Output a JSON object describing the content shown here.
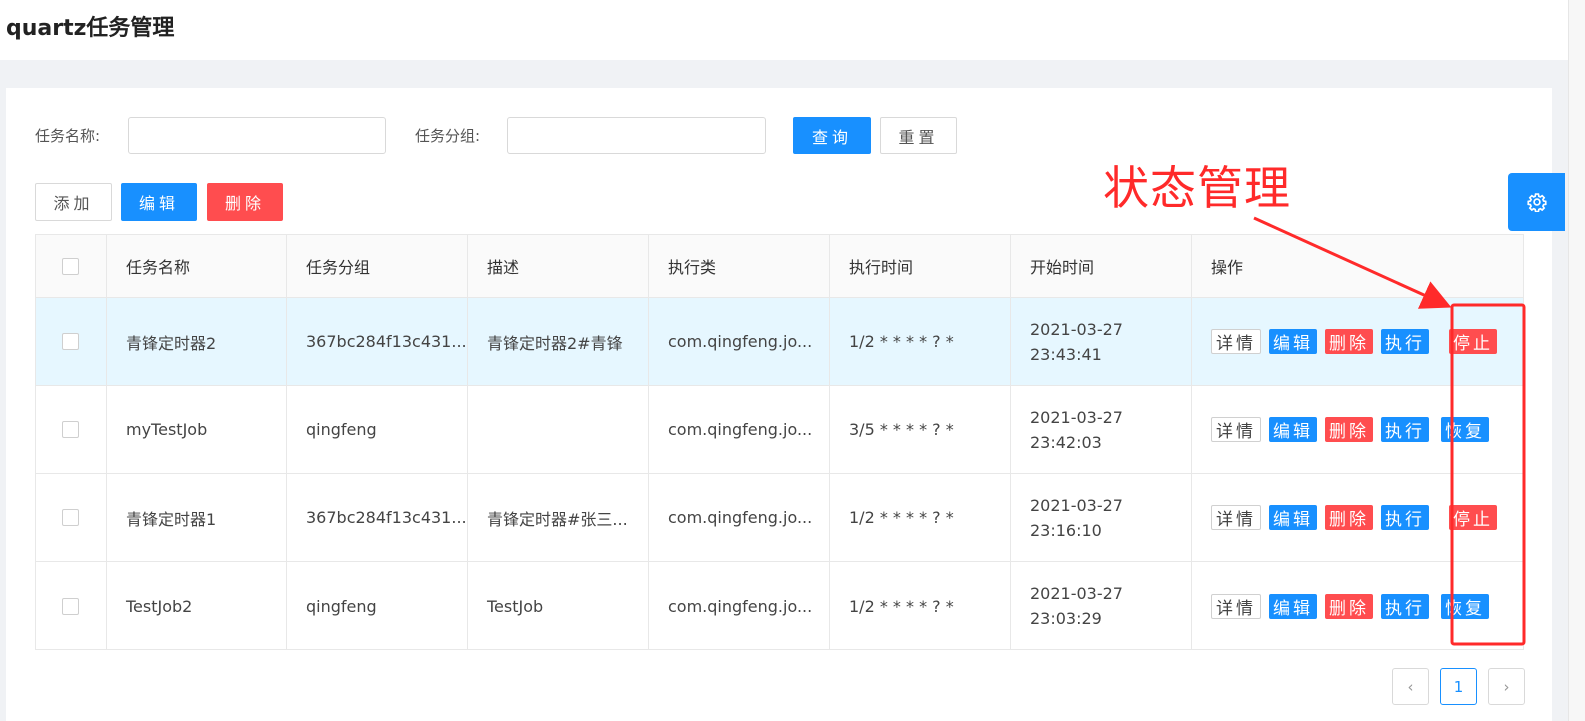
{
  "header": {
    "title": "quartz任务管理"
  },
  "search": {
    "name_label": "任务名称:",
    "name_value": "",
    "group_label": "任务分组:",
    "group_value": "",
    "query_label": "查询",
    "reset_label": "重置"
  },
  "toolbar": {
    "add_label": "添加",
    "edit_label": "编辑",
    "delete_label": "删除"
  },
  "table": {
    "columns": [
      "任务名称",
      "任务分组",
      "描述",
      "执行类",
      "执行时间",
      "开始时间",
      "操作"
    ],
    "rows": [
      {
        "selected_highlight": true,
        "name": "青锋定时器2",
        "group": "367bc284f13c431...",
        "desc": "青锋定时器2#青锋",
        "class": "com.qingfeng.jo...",
        "cron": "1/2 * * * * ? *",
        "start_date": "2021-03-27",
        "start_time": "23:43:41",
        "state_action": "停止",
        "state_color": "red"
      },
      {
        "selected_highlight": false,
        "name": "myTestJob",
        "group": "qingfeng",
        "desc": "",
        "class": "com.qingfeng.jo...",
        "cron": "3/5 * * * * ? *",
        "start_date": "2021-03-27",
        "start_time": "23:42:03",
        "state_action": "恢复",
        "state_color": "blue"
      },
      {
        "selected_highlight": false,
        "name": "青锋定时器1",
        "group": "367bc284f13c431...",
        "desc": "青锋定时器#张三...",
        "class": "com.qingfeng.jo...",
        "cron": "1/2 * * * * ? *",
        "start_date": "2021-03-27",
        "start_time": "23:16:10",
        "state_action": "停止",
        "state_color": "red"
      },
      {
        "selected_highlight": false,
        "name": "TestJob2",
        "group": "qingfeng",
        "desc": "TestJob",
        "class": "com.qingfeng.jo...",
        "cron": "1/2 * * * * ? *",
        "start_date": "2021-03-27",
        "start_time": "23:03:29",
        "state_action": "恢复",
        "state_color": "blue"
      }
    ],
    "row_actions": {
      "detail": "详情",
      "edit": "编辑",
      "delete": "删除",
      "execute": "执行"
    }
  },
  "pagination": {
    "prev": "‹",
    "current": "1",
    "next": "›"
  },
  "settings": {
    "icon": "gear-icon"
  },
  "annotation": {
    "text": "状态管理",
    "color": "#ff2a2a"
  },
  "colors": {
    "primary": "#1890ff",
    "danger": "#ff4d4f",
    "row_highlight": "#e6f7ff"
  }
}
